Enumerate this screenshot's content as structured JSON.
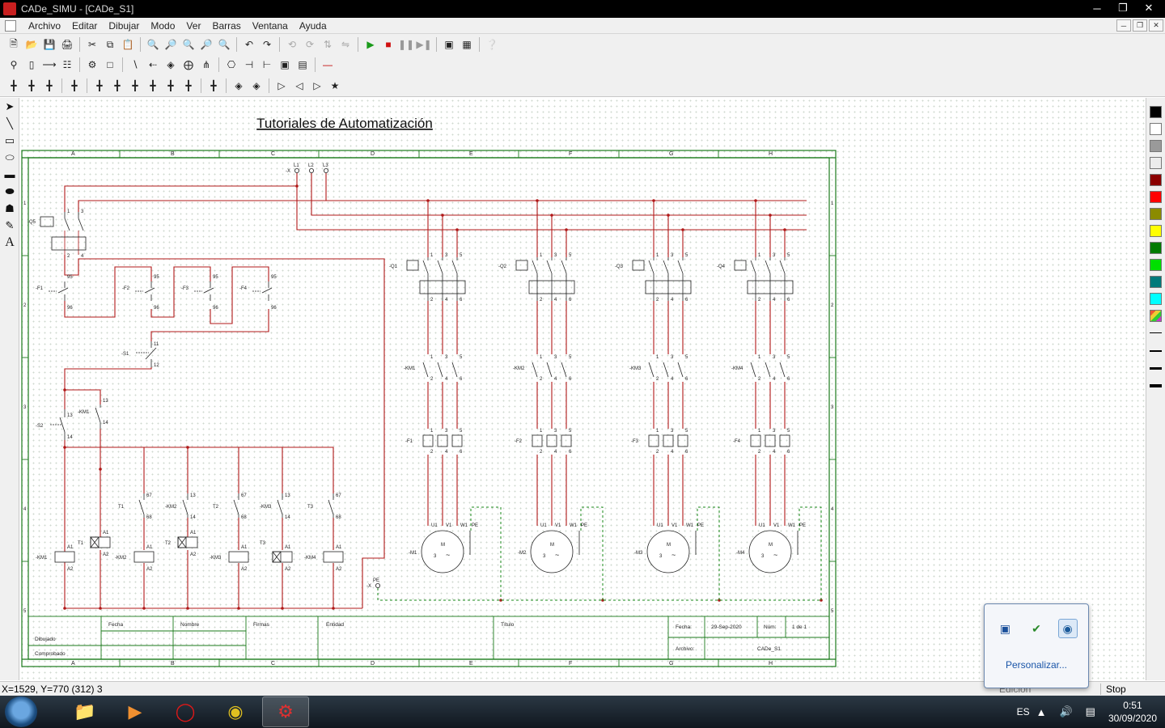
{
  "window": {
    "title": "CADe_SIMU - [CADe_S1]"
  },
  "menu": [
    "Archivo",
    "Editar",
    "Dibujar",
    "Modo",
    "Ver",
    "Barras",
    "Ventana",
    "Ayuda"
  ],
  "drawing": {
    "title": "Tutoriales de Automatización",
    "columns": [
      "A",
      "B",
      "C",
      "D",
      "E",
      "F",
      "G",
      "H"
    ],
    "rows": [
      "1",
      "2",
      "3",
      "4",
      "5"
    ],
    "supply": {
      "terminal": "-X",
      "phases": [
        "L1",
        "L2",
        "L3"
      ]
    },
    "control": {
      "breaker": {
        "label": "-Q5",
        "contacts": [
          "1",
          "2",
          "3",
          "4"
        ]
      },
      "overloads": [
        {
          "label": "-F1",
          "nc": [
            "95",
            "96"
          ]
        },
        {
          "label": "-F2",
          "nc": [
            "95",
            "96"
          ]
        },
        {
          "label": "-F3",
          "nc": [
            "95",
            "96"
          ]
        },
        {
          "label": "-F4",
          "nc": [
            "95",
            "96"
          ]
        }
      ],
      "stop": {
        "label": "-S1",
        "nc": [
          "11",
          "12"
        ]
      },
      "start": {
        "label": "-S2",
        "no": [
          "13",
          "14"
        ]
      },
      "selfhold": {
        "label": "-KM1",
        "no": [
          "13",
          "14"
        ]
      },
      "coils": [
        {
          "label": "-KM1",
          "a1": "A1",
          "a2": "A2"
        },
        {
          "label": "-KM2",
          "a1": "A1",
          "a2": "A2"
        },
        {
          "label": "-KM3",
          "a1": "A1",
          "a2": "A2"
        },
        {
          "label": "-KM4",
          "a1": "A1",
          "a2": "A2"
        }
      ],
      "timers": [
        {
          "label": "T1",
          "a1": "A1",
          "a2": "A2"
        },
        {
          "label": "T2",
          "a1": "A1",
          "a2": "A2"
        },
        {
          "label": "T3",
          "a1": "A1",
          "a2": "A2"
        }
      ],
      "timer_contacts": [
        {
          "label": "T1",
          "no": [
            "67",
            "68"
          ]
        },
        {
          "label": "T2",
          "no": [
            "67",
            "68"
          ]
        },
        {
          "label": "T3",
          "no": [
            "67",
            "68"
          ]
        }
      ],
      "aux_contacts": [
        {
          "label": "-KM2",
          "no": [
            "13",
            "14"
          ]
        },
        {
          "label": "-KM3",
          "no": [
            "13",
            "14"
          ]
        }
      ],
      "pe_terminal": {
        "label": "-X",
        "pe": "PE"
      }
    },
    "power": {
      "breakers": [
        "-Q1",
        "-Q2",
        "-Q3",
        "-Q4"
      ],
      "contactors": [
        "-KM1",
        "-KM2",
        "-KM3",
        "-KM4"
      ],
      "relays": [
        "-F1",
        "-F2",
        "-F3",
        "-F4"
      ],
      "motors": [
        "-M1",
        "-M2",
        "-M3",
        "-M4"
      ],
      "pole_top": [
        "1",
        "3",
        "5"
      ],
      "pole_bottom": [
        "2",
        "4",
        "6"
      ],
      "motor_terminals": [
        "U1",
        "V1",
        "W1",
        "PE"
      ],
      "motor_letter": "M",
      "motor_phases": "3",
      "motor_tilde": "~"
    },
    "titleblock": {
      "fecha_hdr": "Fecha",
      "nombre_hdr": "Nombre",
      "firmas_hdr": "Firmas",
      "entidad_hdr": "Entidad",
      "titulo_hdr": "Título",
      "dibujado": "Dibujado",
      "comprobado": "Comprobado",
      "fecha_label": "Fecha:",
      "fecha_value": "29-Sep-2020",
      "num_label": "Núm:",
      "num_value": "1 de 1",
      "archivo_label": "Archivo:",
      "archivo_value": "CADe_S1"
    }
  },
  "status": {
    "position": "X=1529, Y=770 (312) 3",
    "mode": "Edición",
    "run": "Stop"
  },
  "tray_popup": {
    "link": "Personalizar..."
  },
  "taskbar": {
    "lang": "ES",
    "time": "0:51",
    "date": "30/09/2020"
  },
  "palette": [
    "#000000",
    "#ffffff",
    "#9a9a9a",
    "#ececec",
    "#8b0000",
    "#ff0000",
    "#8b8b00",
    "#ffff00",
    "#007a00",
    "#00e000",
    "#007a7a",
    "#00ffff"
  ]
}
